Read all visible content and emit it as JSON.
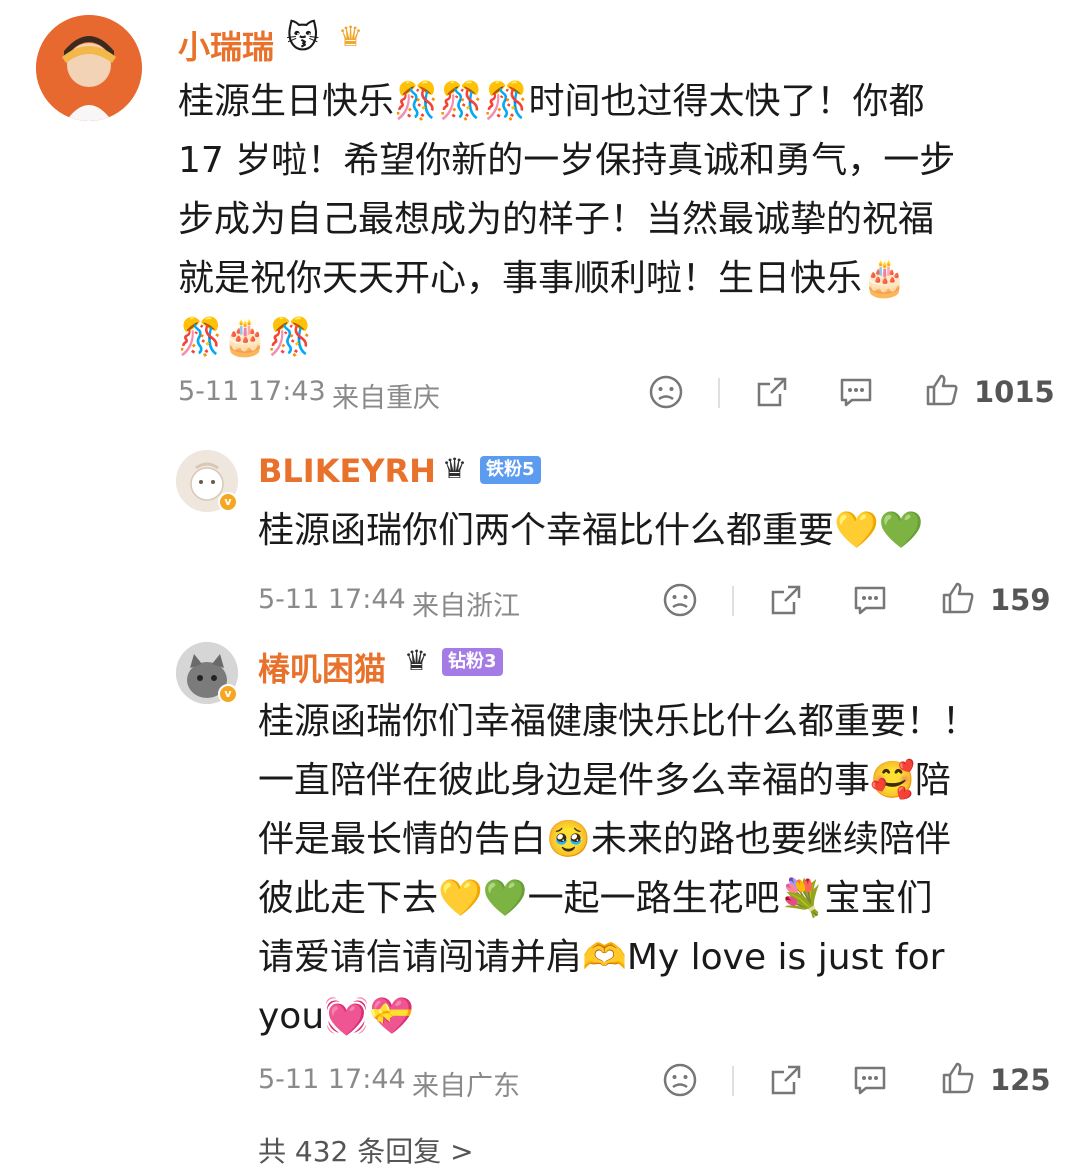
{
  "comment_main": {
    "username": "小瑞瑞",
    "badge_emoji": "😽",
    "lines": [
      "桂源生日快乐🎊🎊🎊时间也过得太快了！你都",
      "17 岁啦！希望你新的一岁保持真诚和勇气，一步",
      "步成为自己最想成为的样子！当然最诚挚的祝福",
      "就是祝你天天开心，事事顺利啦！生日快乐🎂",
      "🎊🎂🎊"
    ],
    "time": "5-11 17:43",
    "location": "来自重庆",
    "likes": "1015"
  },
  "reply_1": {
    "username": "BLIKEYRH",
    "fan_badge": "铁粉5",
    "lines": [
      "桂源函瑞你们两个幸福比什么都重要💛💚"
    ],
    "time": "5-11 17:44",
    "location": "来自浙江",
    "likes": "159"
  },
  "reply_2": {
    "username": "椿叽困猫",
    "fan_badge": "钻粉3",
    "lines": [
      "桂源函瑞你们幸福健康快乐比什么都重要！！",
      "一直陪伴在彼此身边是件多么幸福的事🥰陪",
      "伴是最长情的告白🥹未来的路也要继续陪伴",
      "彼此走下去💛💚一起一路生花吧💐宝宝们",
      "请爱请信请闯请并肩🫶My love is just for",
      "you💓💝"
    ],
    "time": "5-11 17:44",
    "location": "来自广东",
    "likes": "125"
  },
  "more_replies": "共 432 条回复 >",
  "colors": {
    "username": "#e8712b",
    "meta": "#8a8a8a",
    "iron_fan": "#5b9bf0",
    "diamond_fan": "#a57ce6"
  },
  "icons": [
    "crown-icon",
    "sad-face-icon",
    "share-icon",
    "comment-icon",
    "thumbs-up-icon"
  ]
}
